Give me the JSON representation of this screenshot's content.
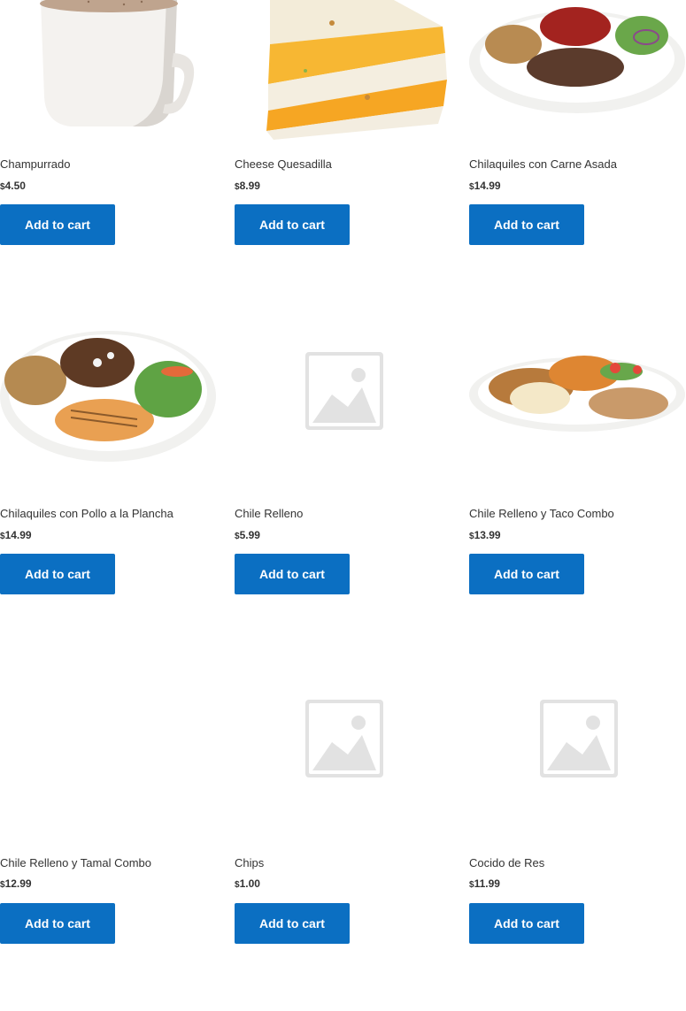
{
  "products": [
    {
      "name": "Champurrado",
      "currency": "$",
      "price": "4.50",
      "button": "Add to cart",
      "image": "champurrado-mug-image"
    },
    {
      "name": "Cheese Quesadilla",
      "currency": "$",
      "price": "8.99",
      "button": "Add to cart",
      "image": "cheese-quesadilla-image"
    },
    {
      "name": "Chilaquiles con Carne Asada",
      "currency": "$",
      "price": "14.99",
      "button": "Add to cart",
      "image": "chilaquiles-carne-asada-image"
    },
    {
      "name": "Chilaquiles con Pollo a la Plancha",
      "currency": "$",
      "price": "14.99",
      "button": "Add to cart",
      "image": "chilaquiles-pollo-image"
    },
    {
      "name": "Chile Relleno",
      "currency": "$",
      "price": "5.99",
      "button": "Add to cart",
      "image": "placeholder-image"
    },
    {
      "name": "Chile Relleno y Taco Combo",
      "currency": "$",
      "price": "13.99",
      "button": "Add to cart",
      "image": "chile-relleno-taco-combo-image"
    },
    {
      "name": "Chile Relleno y Tamal Combo",
      "currency": "$",
      "price": "12.99",
      "button": "Add to cart",
      "image": "none"
    },
    {
      "name": "Chips",
      "currency": "$",
      "price": "1.00",
      "button": "Add to cart",
      "image": "placeholder-image"
    },
    {
      "name": "Cocido de Res",
      "currency": "$",
      "price": "11.99",
      "button": "Add to cart",
      "image": "placeholder-image"
    }
  ],
  "colors": {
    "button_bg": "#0b6fc2",
    "button_text": "#ffffff",
    "text": "#333333",
    "placeholder": "#e2e2e2"
  }
}
